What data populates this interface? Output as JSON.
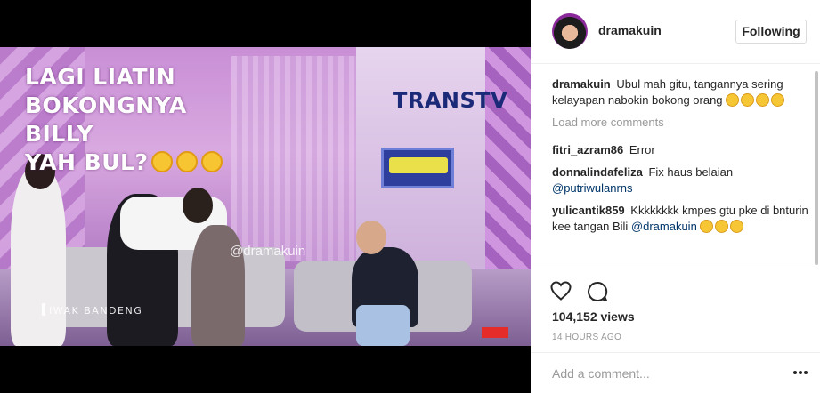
{
  "media": {
    "caption_lines": [
      "LAGI LIATIN",
      "BOKONGNYA BILLY",
      "YAH BUL?"
    ],
    "channel_logo": "TRANSTV",
    "watermark": "@dramakuin",
    "show_tag": "IWAK BANDENG",
    "emoji_icon": "laughing-tears-emoji"
  },
  "header": {
    "username": "dramakuin",
    "follow_label": "Following"
  },
  "caption": {
    "user": "dramakuin",
    "text": "Ubul mah gitu, tangannya sering kelayapan nabokin bokong orang"
  },
  "load_more": "Load more comments",
  "comments": [
    {
      "user": "fitri_azram86",
      "text": "Error",
      "mention": ""
    },
    {
      "user": "donnalindafeliza",
      "text": "Fix haus belaian",
      "mention": "@putriwulanrns"
    },
    {
      "user": "yulicantik859",
      "text": "Kkkkkkkk kmpes gtu pke di bnturin kee tangan Bili",
      "mention": "@dramakuin"
    }
  ],
  "actions": {
    "views": "104,152 views",
    "time": "14 HOURS AGO"
  },
  "add_comment": {
    "placeholder": "Add a comment..."
  },
  "colors": {
    "text": "#262626",
    "muted": "#999999",
    "mention": "#003569",
    "border": "#efefef"
  }
}
